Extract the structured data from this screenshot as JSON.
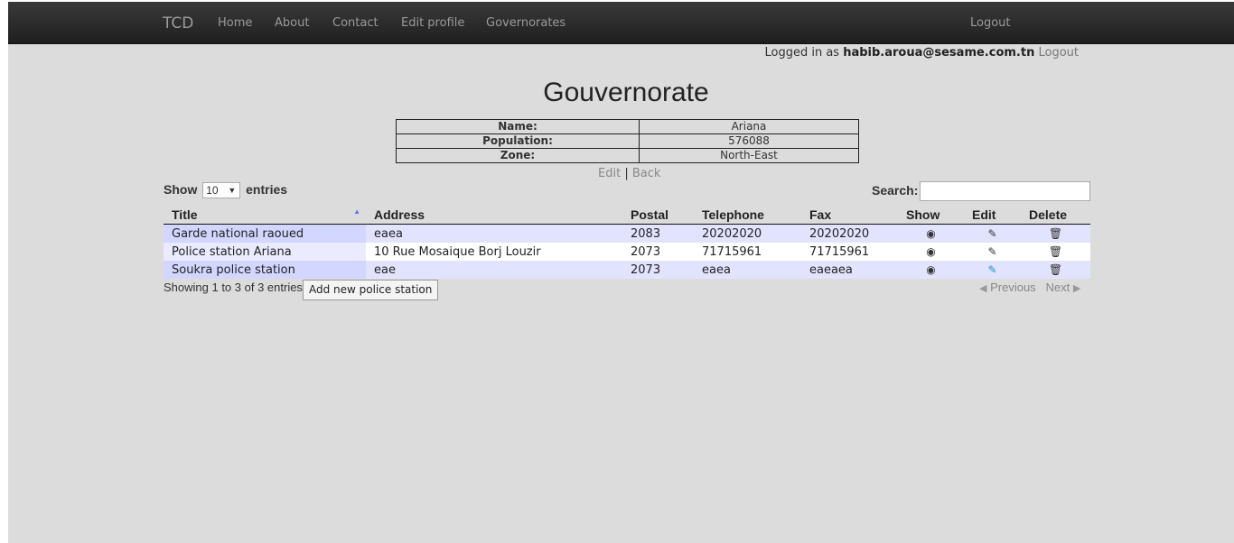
{
  "navbar": {
    "brand": "TCD",
    "links": [
      "Home",
      "About",
      "Contact",
      "Edit profile",
      "Governorates"
    ],
    "logout": "Logout"
  },
  "session": {
    "prefix": "Logged in as",
    "user": "habib.aroua@sesame.com.tn",
    "logout": "Logout"
  },
  "page_title": "Gouvernorate",
  "details": [
    {
      "label": "Name:",
      "value": "Ariana"
    },
    {
      "label": "Population:",
      "value": "576088"
    },
    {
      "label": "Zone:",
      "value": "North-East"
    }
  ],
  "actions": {
    "edit": "Edit",
    "separator": "|",
    "back": "Back"
  },
  "length_control": {
    "prefix": "Show",
    "value": "10",
    "suffix": "entries"
  },
  "search": {
    "label": "Search:",
    "value": ""
  },
  "table": {
    "columns": [
      "Title",
      "Address",
      "Postal",
      "Telephone",
      "Fax",
      "Show",
      "Edit",
      "Delete"
    ],
    "rows": [
      {
        "title": "Garde national raoued",
        "address": "eaea",
        "postal": "2083",
        "telephone": "20202020",
        "fax": "20202020"
      },
      {
        "title": "Police station Ariana",
        "address": "10 Rue Mosaique Borj Louzir",
        "postal": "2073",
        "telephone": "71715961",
        "fax": "71715961"
      },
      {
        "title": "Soukra police station",
        "address": "eae",
        "postal": "2073",
        "telephone": "eaea",
        "fax": "eaeaea"
      }
    ]
  },
  "footer": {
    "info": "Showing 1 to 3 of 3 entries",
    "add_button": "Add new police station",
    "previous": "Previous",
    "next": "Next"
  },
  "icons": {
    "show": "eye-icon",
    "edit": "pencil-icon",
    "delete": "trash-icon"
  }
}
